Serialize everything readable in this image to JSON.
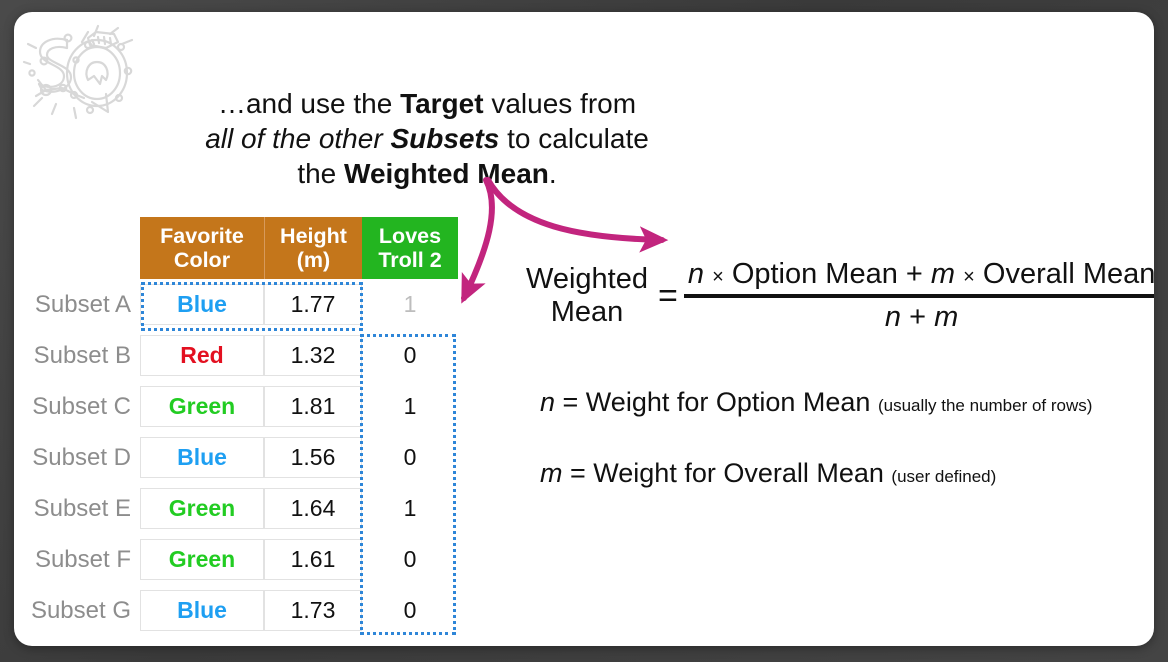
{
  "slide": {
    "logo_name": "statquest-sq-logo",
    "headline": {
      "line1_pre": "…and use the ",
      "line1_bold": "Target",
      "line1_post": " values from",
      "line2_italic": "all of the other ",
      "line2_bolditalic": "Subsets",
      "line2_post": " to calculate",
      "line3_pre": "the ",
      "line3_bold": "Weighted Mean",
      "line3_post": "."
    }
  },
  "table": {
    "headers": [
      {
        "line1": "Favorite",
        "line2": "Color",
        "color": "#c4761b"
      },
      {
        "line1": "Height",
        "line2": "(m)",
        "color": "#c4761b"
      },
      {
        "line1": "Loves",
        "line2": "Troll 2",
        "color": "#23b520"
      }
    ],
    "rows": [
      {
        "label": "Subset A",
        "color": "Blue",
        "color_class": "txt-blue",
        "height": "1.77",
        "troll": "1",
        "troll_dim": true
      },
      {
        "label": "Subset B",
        "color": "Red",
        "color_class": "txt-red",
        "height": "1.32",
        "troll": "0",
        "troll_dim": false
      },
      {
        "label": "Subset C",
        "color": "Green",
        "color_class": "txt-green",
        "height": "1.81",
        "troll": "1",
        "troll_dim": false
      },
      {
        "label": "Subset D",
        "color": "Blue",
        "color_class": "txt-blue",
        "height": "1.56",
        "troll": "0",
        "troll_dim": false
      },
      {
        "label": "Subset E",
        "color": "Green",
        "color_class": "txt-green",
        "height": "1.64",
        "troll": "1",
        "troll_dim": false
      },
      {
        "label": "Subset F",
        "color": "Green",
        "color_class": "txt-green",
        "height": "1.61",
        "troll": "0",
        "troll_dim": false
      },
      {
        "label": "Subset G",
        "color": "Blue",
        "color_class": "txt-blue",
        "height": "1.73",
        "troll": "0",
        "troll_dim": false
      }
    ],
    "highlight_color": "#2e86d8"
  },
  "formula": {
    "label_line1": "Weighted",
    "label_line2": "Mean",
    "equals": "=",
    "numerator_n": "n",
    "numerator_times1": "×",
    "numerator_option": "Option Mean",
    "numerator_plus": "+",
    "numerator_m": "m",
    "numerator_times2": "×",
    "numerator_overall": "Overall Mean",
    "denominator_n": "n",
    "denominator_plus": "+",
    "denominator_m": "m"
  },
  "legend": {
    "n_var": "n",
    "n_text": " = Weight for Option Mean ",
    "n_note": "(usually the number of rows)",
    "m_var": "m",
    "m_text": " = Weight for Overall Mean ",
    "m_note": "(user defined)"
  },
  "arrows": {
    "color": "#c2257e",
    "count": 2
  }
}
